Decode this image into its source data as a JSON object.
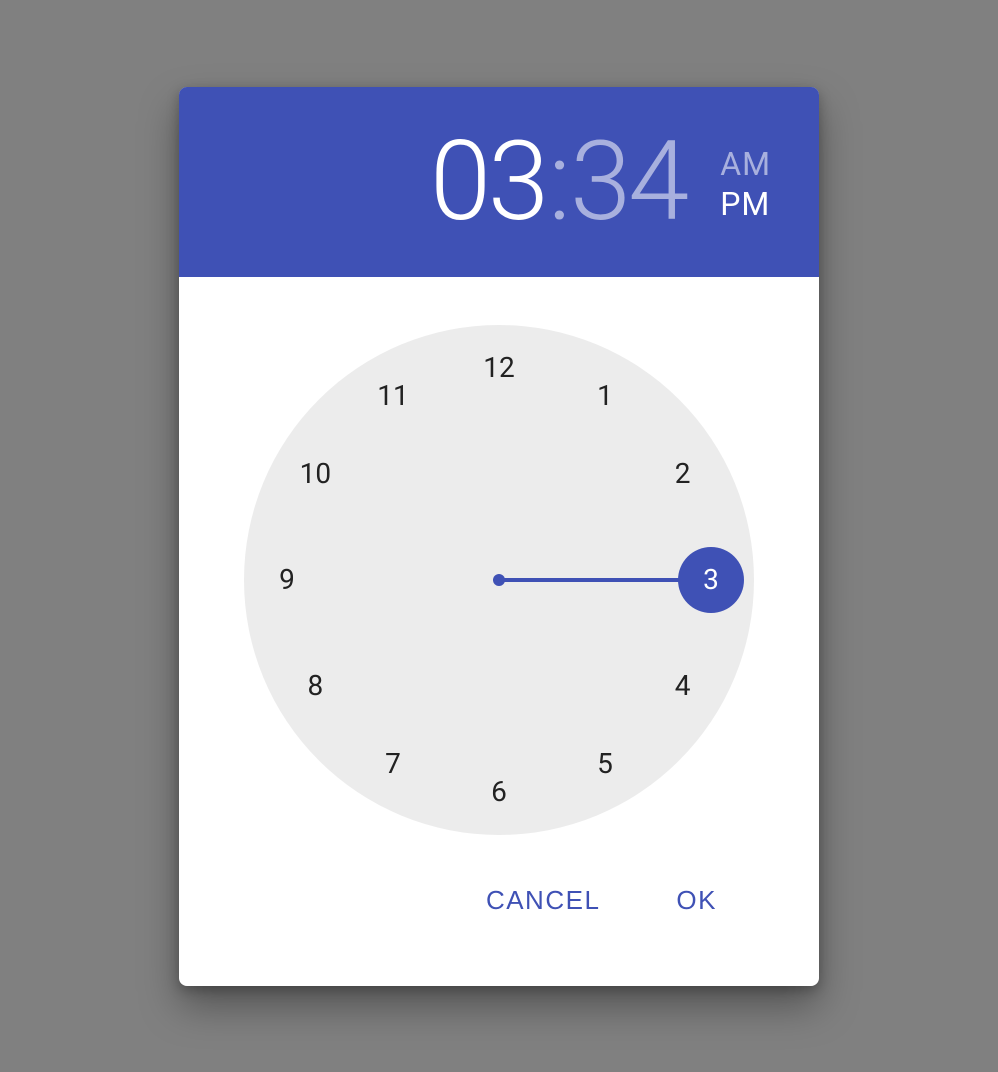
{
  "header": {
    "hours": "03",
    "colon": ":",
    "minutes": "34",
    "am_label": "AM",
    "pm_label": "PM",
    "period_selected": "PM",
    "mode": "hours"
  },
  "clock": {
    "numbers": [
      "12",
      "1",
      "2",
      "3",
      "4",
      "5",
      "6",
      "7",
      "8",
      "9",
      "10",
      "11"
    ],
    "selected_hour": 3,
    "radius_px": 255,
    "num_radius_px": 212,
    "hand_angle_deg": 0
  },
  "actions": {
    "cancel_label": "CANCEL",
    "ok_label": "OK"
  },
  "colors": {
    "primary": "#3f51b5",
    "clock_face": "#ececec",
    "background": "#808080"
  }
}
